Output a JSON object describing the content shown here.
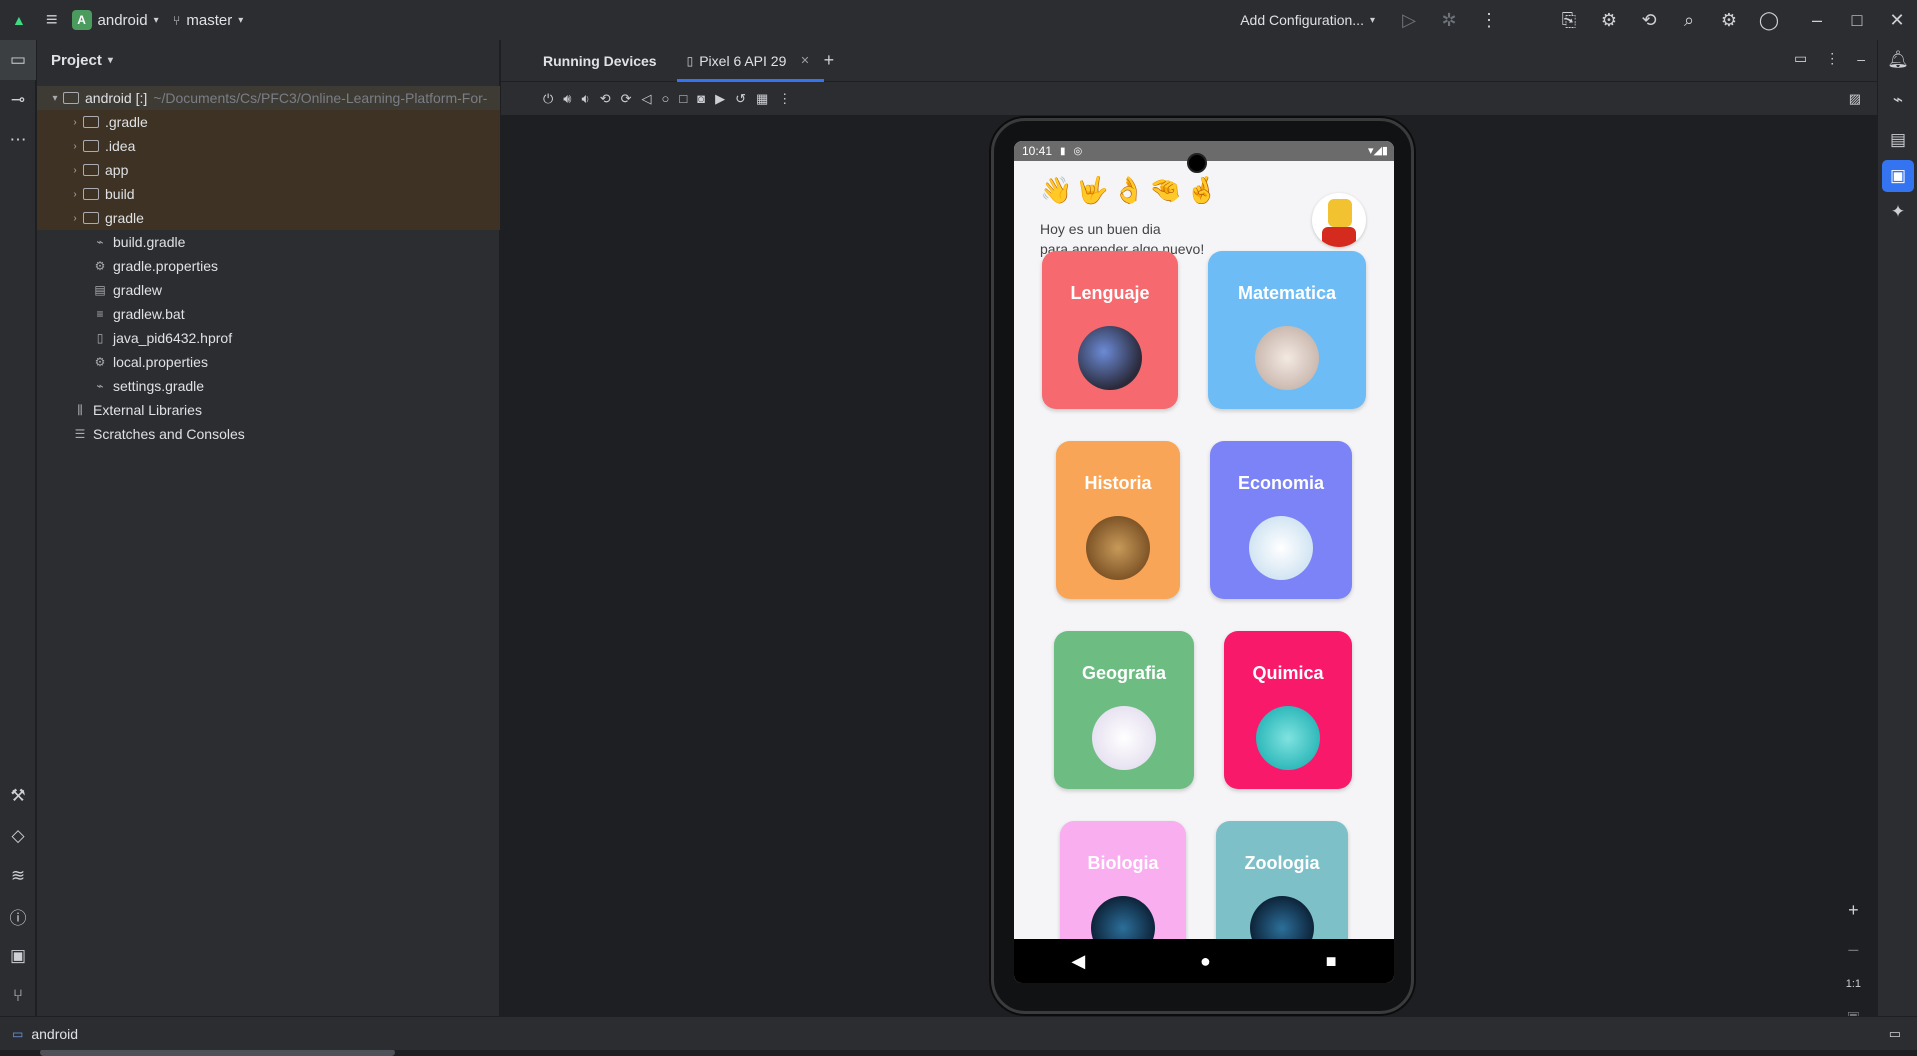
{
  "titlebar": {
    "project_badge": "A",
    "project_name": "android",
    "branch": "master",
    "run_config": "Add Configuration..."
  },
  "project_panel": {
    "title": "Project",
    "root_name": "android [:]",
    "root_path": "~/Documents/Cs/PFC3/Online-Learning-Platform-For-",
    "folders": [
      ".gradle",
      ".idea",
      "app",
      "build",
      "gradle"
    ],
    "files": [
      "build.gradle",
      "gradle.properties",
      "gradlew",
      "gradlew.bat",
      "java_pid6432.hprof",
      "local.properties",
      "settings.gradle"
    ],
    "external": "External Libraries",
    "scratches": "Scratches and Consoles"
  },
  "main": {
    "tab_running": "Running Devices",
    "tab_device": "Pixel 6 API 29"
  },
  "zoom": {
    "one_to_one": "1:1"
  },
  "status_bar": {
    "project": "android"
  },
  "phone": {
    "time": "10:41",
    "emojis": "👋🤟👌🤏🤞",
    "greeting_line1": "Hoy es un buen dia",
    "greeting_line2": "para aprender algo nuevo!",
    "subjects": [
      {
        "name": "Lenguaje",
        "color": "#f6696e"
      },
      {
        "name": "Matematica",
        "color": "#6ebcf6"
      },
      {
        "name": "Historia",
        "color": "#f9a557"
      },
      {
        "name": "Economia",
        "color": "#7b83f7"
      },
      {
        "name": "Geografia",
        "color": "#6dbd83"
      },
      {
        "name": "Quimica",
        "color": "#f8196b"
      },
      {
        "name": "Biologia",
        "color": "#f9aef0"
      },
      {
        "name": "Zoologia",
        "color": "#7ec0c8"
      }
    ]
  }
}
